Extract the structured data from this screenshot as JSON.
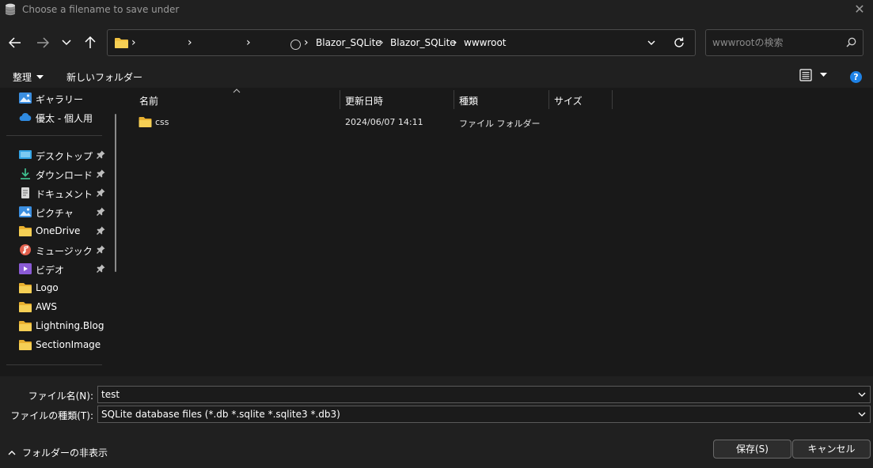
{
  "window": {
    "title": "Choose a filename to save under",
    "close_glyph": "✕"
  },
  "nav": {
    "breadcrumbs": [
      "Blazor_SQLite",
      "Blazor_SQLite",
      "wwwroot"
    ],
    "search_placeholder": "wwwrootの検索"
  },
  "toolbar": {
    "organize_label": "整理",
    "new_folder_label": "新しいフォルダー",
    "help_glyph": "?"
  },
  "sidebar": {
    "items": [
      {
        "label": "ギャラリー",
        "icon": "gallery-icon",
        "pinned": false
      },
      {
        "label": "優太 - 個人用",
        "icon": "onedrive-cloud-icon",
        "pinned": false
      },
      {
        "label": "デスクトップ",
        "icon": "desktop-icon",
        "pinned": true
      },
      {
        "label": "ダウンロード",
        "icon": "download-icon",
        "pinned": true
      },
      {
        "label": "ドキュメント",
        "icon": "document-icon",
        "pinned": true
      },
      {
        "label": "ピクチャ",
        "icon": "pictures-icon",
        "pinned": true
      },
      {
        "label": "OneDrive",
        "icon": "folder-icon",
        "pinned": true
      },
      {
        "label": "ミュージック",
        "icon": "music-icon",
        "pinned": true
      },
      {
        "label": "ビデオ",
        "icon": "video-icon",
        "pinned": true
      },
      {
        "label": "Logo",
        "icon": "folder-icon",
        "pinned": false
      },
      {
        "label": "AWS",
        "icon": "folder-icon",
        "pinned": false
      },
      {
        "label": "Lightning.Blog",
        "icon": "folder-icon",
        "pinned": false
      },
      {
        "label": "SectionImage",
        "icon": "folder-icon",
        "pinned": false
      }
    ]
  },
  "files": {
    "columns": [
      "名前",
      "更新日時",
      "種類",
      "サイズ"
    ],
    "rows": [
      {
        "name": "css",
        "modified": "2024/06/07 14:11",
        "type": "ファイル フォルダー",
        "size": ""
      }
    ]
  },
  "form": {
    "filename_label": "ファイル名(N):",
    "filename_value": "test",
    "filetype_label": "ファイルの種類(T):",
    "filetype_value": "SQLite database files (*.db *.sqlite *.sqlite3 *.db3)",
    "hide_folders_label": "フォルダーの非表示",
    "save_label": "保存(S)",
    "cancel_label": "キャンセル"
  },
  "colors": {
    "background": "#191919",
    "panel": "#202020",
    "folder": "#f0c040",
    "help": "#1e82e6"
  }
}
